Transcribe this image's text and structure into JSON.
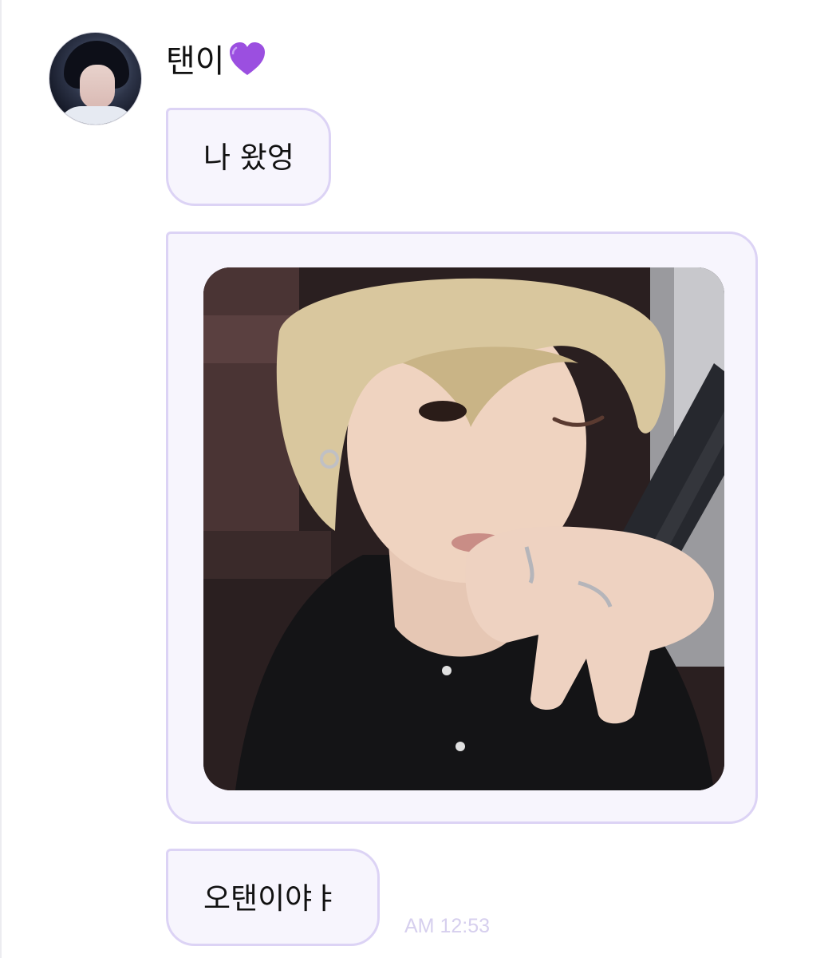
{
  "sender": {
    "name": "탠이",
    "name_icon": "purple-heart-icon",
    "avatar": "profile-avatar"
  },
  "messages": [
    {
      "type": "text",
      "text": "나 왔엉"
    },
    {
      "type": "image",
      "description_icon": "selfie-photo"
    },
    {
      "type": "text",
      "text": "오탠이야ㅑ"
    }
  ],
  "timestamp": "AM 12:53",
  "colors": {
    "bubble_background": "#f7f5fd",
    "bubble_border": "#dcd3f5",
    "heart": "#9b4fe0",
    "timestamp": "#d6cfee"
  }
}
